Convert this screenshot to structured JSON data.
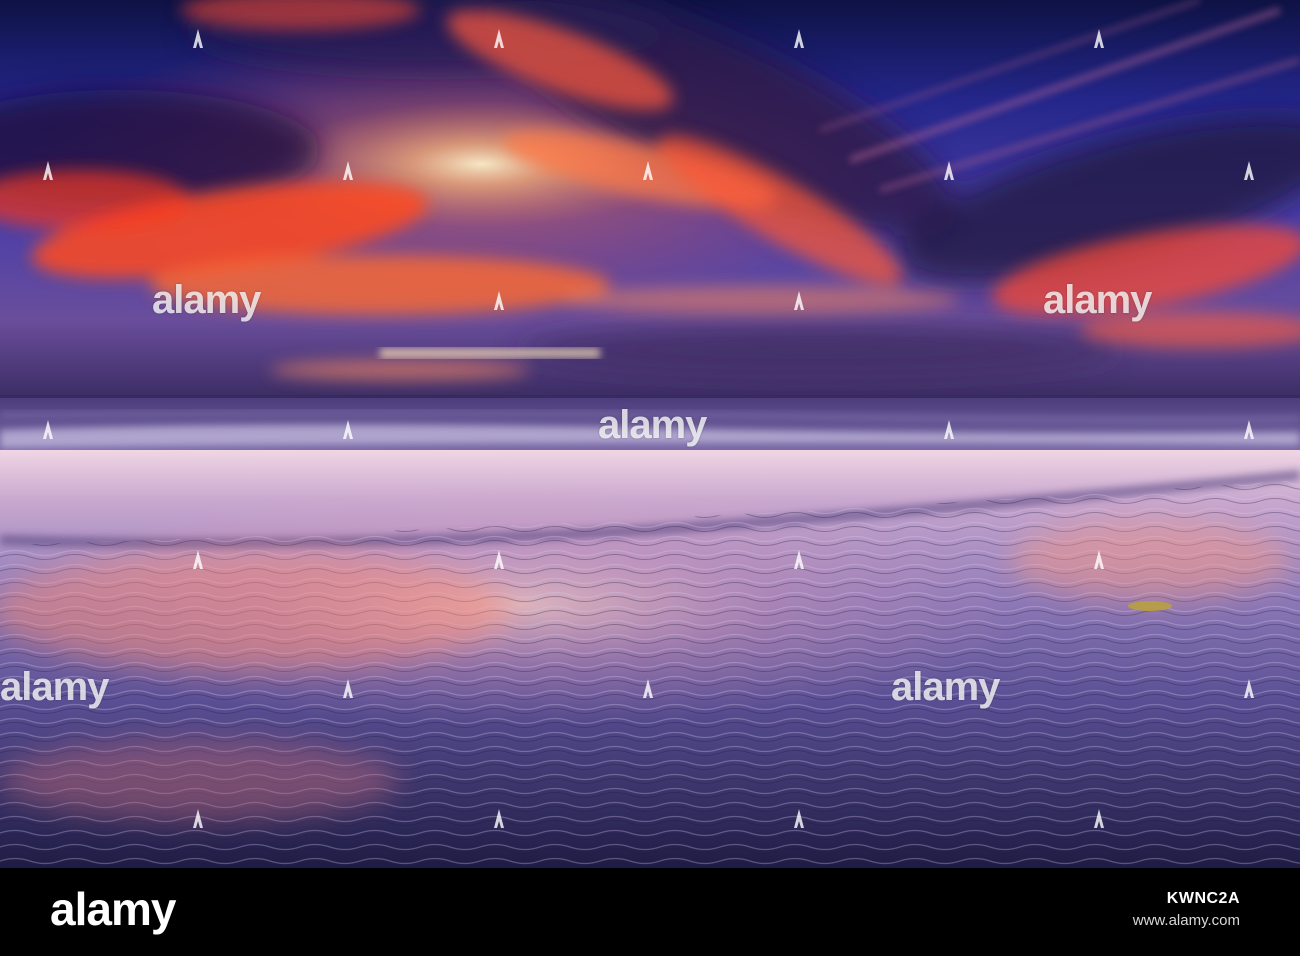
{
  "photo": {
    "watermark_text": "alamy",
    "colors": {
      "sky_top": "#101548",
      "sky_mid": "#3a3aa8",
      "cloud_glow": "#ff5a2a",
      "cloud_dark": "#2a1a4a",
      "horizon": "#ffb090",
      "sea": "#6a5a9a",
      "sand_light": "#e9c8d8",
      "sand_dark": "#232048"
    }
  },
  "footer": {
    "logo": "alamy",
    "image_id": "KWNC2A",
    "url": "www.alamy.com"
  }
}
